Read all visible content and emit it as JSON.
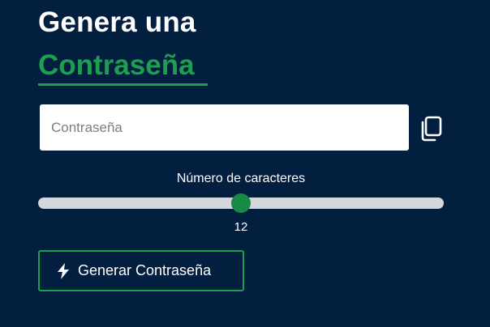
{
  "header": {
    "title_line1": "Genera una",
    "title_line2": "Contraseña"
  },
  "password_field": {
    "value": "",
    "placeholder": "Contraseña"
  },
  "copy_button": {
    "icon": "copy-icon"
  },
  "length_control": {
    "label": "Número de caracteres",
    "value": 12,
    "value_text": "12",
    "position_fraction": 0.5
  },
  "generate_button": {
    "icon": "bolt-icon",
    "label": "Generar Contraseña"
  },
  "colors": {
    "background": "#021f40",
    "accent": "#1e9e4f",
    "slider_thumb": "#198a46",
    "slider_track": "#d4d7dc"
  }
}
